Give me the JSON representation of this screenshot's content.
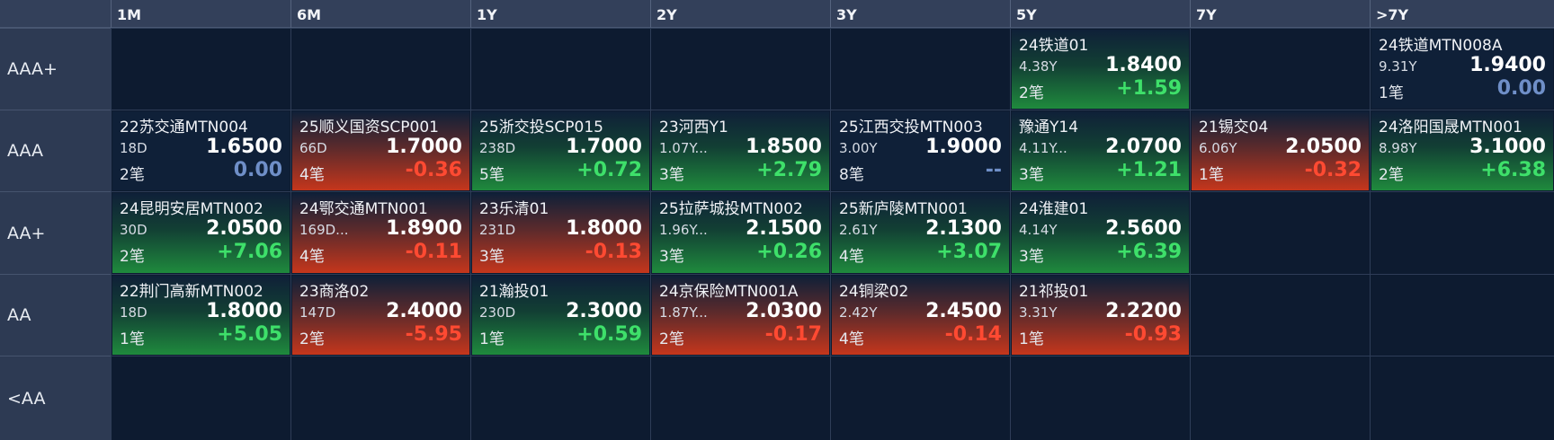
{
  "columns": [
    "1M",
    "6M",
    "1Y",
    "2Y",
    "3Y",
    "5Y",
    "7Y",
    ">7Y"
  ],
  "rows": [
    "AAA+",
    "AAA",
    "AA+",
    "AA",
    "<AA"
  ],
  "colors": {
    "background": "#0c1a2e",
    "header": "#33405a",
    "positive": "#3ee06a",
    "negative": "#ff4a32",
    "zero": "#6f8fc8"
  },
  "cells": [
    {
      "row": 0,
      "col": 5,
      "name": "24铁道01",
      "term": "4.38Y",
      "yield": "1.8400",
      "count": "2笔",
      "change": "+1.59",
      "trend": "green",
      "chg": "pos"
    },
    {
      "row": 0,
      "col": 7,
      "name": "24铁道MTN008A",
      "term": "9.31Y",
      "yield": "1.9400",
      "count": "1笔",
      "change": "0.00",
      "trend": "neutral",
      "chg": "zero"
    },
    {
      "row": 1,
      "col": 0,
      "name": "22苏交通MTN004",
      "term": "18D",
      "yield": "1.6500",
      "count": "2笔",
      "change": "0.00",
      "trend": "neutral",
      "chg": "zero"
    },
    {
      "row": 1,
      "col": 1,
      "name": "25顺义国资SCP001",
      "term": "66D",
      "yield": "1.7000",
      "count": "4笔",
      "change": "-0.36",
      "trend": "red",
      "chg": "neg"
    },
    {
      "row": 1,
      "col": 2,
      "name": "25浙交投SCP015",
      "term": "238D",
      "yield": "1.7000",
      "count": "5笔",
      "change": "+0.72",
      "trend": "green",
      "chg": "pos"
    },
    {
      "row": 1,
      "col": 3,
      "name": "23河西Y1",
      "term": "1.07Y...",
      "yield": "1.8500",
      "count": "3笔",
      "change": "+2.79",
      "trend": "green",
      "chg": "pos"
    },
    {
      "row": 1,
      "col": 4,
      "name": "25江西交投MTN003",
      "term": "3.00Y",
      "yield": "1.9000",
      "count": "8笔",
      "change": "--",
      "trend": "neutral",
      "chg": "na"
    },
    {
      "row": 1,
      "col": 5,
      "name": "豫通Y14",
      "term": "4.11Y...",
      "yield": "2.0700",
      "count": "3笔",
      "change": "+1.21",
      "trend": "green",
      "chg": "pos"
    },
    {
      "row": 1,
      "col": 6,
      "name": "21锡交04",
      "term": "6.06Y",
      "yield": "2.0500",
      "count": "1笔",
      "change": "-0.32",
      "trend": "red",
      "chg": "neg"
    },
    {
      "row": 1,
      "col": 7,
      "name": "24洛阳国晟MTN001",
      "term": "8.98Y",
      "yield": "3.1000",
      "count": "2笔",
      "change": "+6.38",
      "trend": "green",
      "chg": "pos"
    },
    {
      "row": 2,
      "col": 0,
      "name": "24昆明安居MTN002",
      "term": "30D",
      "yield": "2.0500",
      "count": "2笔",
      "change": "+7.06",
      "trend": "green",
      "chg": "pos"
    },
    {
      "row": 2,
      "col": 1,
      "name": "24鄂交通MTN001",
      "term": "169D...",
      "yield": "1.8900",
      "count": "4笔",
      "change": "-0.11",
      "trend": "red",
      "chg": "neg"
    },
    {
      "row": 2,
      "col": 2,
      "name": "23乐清01",
      "term": "231D",
      "yield": "1.8000",
      "count": "3笔",
      "change": "-0.13",
      "trend": "red",
      "chg": "neg"
    },
    {
      "row": 2,
      "col": 3,
      "name": "25拉萨城投MTN002",
      "term": "1.96Y...",
      "yield": "2.1500",
      "count": "3笔",
      "change": "+0.26",
      "trend": "green",
      "chg": "pos"
    },
    {
      "row": 2,
      "col": 4,
      "name": "25新庐陵MTN001",
      "term": "2.61Y",
      "yield": "2.1300",
      "count": "4笔",
      "change": "+3.07",
      "trend": "green",
      "chg": "pos"
    },
    {
      "row": 2,
      "col": 5,
      "name": "24淮建01",
      "term": "4.14Y",
      "yield": "2.5600",
      "count": "3笔",
      "change": "+6.39",
      "trend": "green",
      "chg": "pos"
    },
    {
      "row": 3,
      "col": 0,
      "name": "22荆门高新MTN002",
      "term": "18D",
      "yield": "1.8000",
      "count": "1笔",
      "change": "+5.05",
      "trend": "green",
      "chg": "pos"
    },
    {
      "row": 3,
      "col": 1,
      "name": "23商洛02",
      "term": "147D",
      "yield": "2.4000",
      "count": "2笔",
      "change": "-5.95",
      "trend": "red",
      "chg": "neg"
    },
    {
      "row": 3,
      "col": 2,
      "name": "21瀚投01",
      "term": "230D",
      "yield": "2.3000",
      "count": "1笔",
      "change": "+0.59",
      "trend": "green",
      "chg": "pos"
    },
    {
      "row": 3,
      "col": 3,
      "name": "24京保险MTN001A",
      "term": "1.87Y...",
      "yield": "2.0300",
      "count": "2笔",
      "change": "-0.17",
      "trend": "red",
      "chg": "neg"
    },
    {
      "row": 3,
      "col": 4,
      "name": "24铜梁02",
      "term": "2.42Y",
      "yield": "2.4500",
      "count": "4笔",
      "change": "-0.14",
      "trend": "red",
      "chg": "neg"
    },
    {
      "row": 3,
      "col": 5,
      "name": "21祁投01",
      "term": "3.31Y",
      "yield": "2.2200",
      "count": "1笔",
      "change": "-0.93",
      "trend": "red",
      "chg": "neg"
    }
  ]
}
